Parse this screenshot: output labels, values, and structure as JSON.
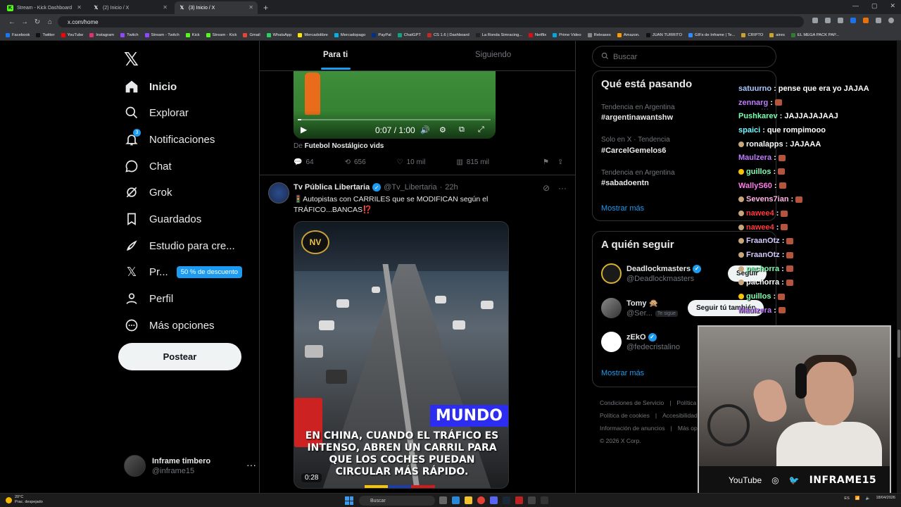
{
  "browser": {
    "tabs": [
      {
        "title": "Stream - Kick Dashboard",
        "active": false,
        "favicon": "kick-icon"
      },
      {
        "title": "(2) Inicio / X",
        "active": false,
        "favicon": "x-icon"
      },
      {
        "title": "(3) Inicio / X",
        "active": true,
        "favicon": "x-icon"
      }
    ],
    "url": "x.com/home",
    "bookmarks": [
      "Facebook",
      "Twitter",
      "YouTube",
      "Instagram",
      "Twitch",
      "Stream - Twitch",
      "Kick",
      "Stream - Kick",
      "Gmail",
      "WhatsApp",
      "Mercadolibre",
      "Mercadopago",
      "PayPal",
      "ChatGPT",
      "CS 1.6 | Dashboard",
      "La Ronda Simracing...",
      "Netflix",
      "Prime Video",
      "Releases",
      "Amazon.",
      "JUAN TURRITO",
      "GIFs de Inframe | Te...",
      "CRIPTO",
      "aires",
      "EL MEGA PACK PAP..."
    ]
  },
  "nav": {
    "items": [
      {
        "label": "Inicio",
        "icon": "home-icon"
      },
      {
        "label": "Explorar",
        "icon": "search-icon"
      },
      {
        "label": "Notificaciones",
        "icon": "bell-icon",
        "badge": "3"
      },
      {
        "label": "Chat",
        "icon": "chat-icon"
      },
      {
        "label": "Grok",
        "icon": "grok-icon"
      },
      {
        "label": "Guardados",
        "icon": "bookmark-icon"
      },
      {
        "label": "Estudio para cre...",
        "icon": "rocket-icon"
      },
      {
        "label": "Pr...",
        "icon": "x-premium-icon"
      },
      {
        "label": "Perfil",
        "icon": "user-icon"
      },
      {
        "label": "Más opciones",
        "icon": "more-icon"
      }
    ],
    "premium_badge": "50 % de descuento",
    "post_button": "Postear",
    "profile": {
      "name": "Inframe timbero",
      "handle": "@inframe15"
    }
  },
  "feed": {
    "tabs": [
      "Para ti",
      "Siguiendo"
    ],
    "tweet1": {
      "video_time": "0:07 / 1:00",
      "from_prefix": "De",
      "from_source": "Futebol Nostálgico vids",
      "replies": "64",
      "reposts": "656",
      "likes": "10 mil",
      "views": "815 mil"
    },
    "tweet2": {
      "name": "Tv Pública Libertaria",
      "handle": "@Tv_Libertaria",
      "time": "22h",
      "text_line1": "🚦Autopistas con CARRILES que se MODIFICAN según el",
      "text_line2": "TRÁFICO...BANCAS⁉️",
      "overlay_logo": "NV",
      "overlay_tag": "MUNDO",
      "overlay_caption": "EN CHINA, CUANDO EL TRÁFICO ES INTENSO, ABREN UN CARRIL PARA QUE LOS COCHES PUEDAN CIRCULAR MÁS RÁPIDO.",
      "duration": "0:28"
    }
  },
  "sidebar": {
    "search_placeholder": "Buscar",
    "trends_title": "Qué está pasando",
    "trends": [
      {
        "meta": "Tendencia en Argentina",
        "tag": "#argentinawantshw"
      },
      {
        "meta": "Solo en X · Tendencia",
        "tag": "#CarcelGemelos6"
      },
      {
        "meta": "Tendencia en Argentina",
        "tag": "#sabadoentn"
      }
    ],
    "show_more": "Mostrar más",
    "who_title": "A quién seguir",
    "who": [
      {
        "name": "Deadlockmasters",
        "handle": "@Deadlockmasters",
        "verified": true,
        "button": "Seguir"
      },
      {
        "name": "Tomy 🙊",
        "handle": "@Ser...",
        "follows_you": "Te sigue",
        "button": "Seguir tú también"
      },
      {
        "name": "zEkO",
        "handle": "@fedecristalino",
        "verified": true
      }
    ],
    "footer": [
      "Condiciones de Servicio",
      "Política",
      "Política de cookies",
      "Accesibilidad",
      "Información de anuncios",
      "Más op",
      "© 2026 X Corp."
    ]
  },
  "chat": [
    {
      "user": "satuurno",
      "msg": "pense que era yo JAJAA",
      "color": "#a8c8ff"
    },
    {
      "user": "zennarg",
      "msg": "",
      "color": "#c07cff",
      "emote": true
    },
    {
      "user": "Pushkarev",
      "msg": "JAJJAJAJAAJ",
      "color": "#7dffb0"
    },
    {
      "user": "spaici",
      "msg": "que rompimooo",
      "color": "#7df7ff"
    },
    {
      "user": "ronalapps",
      "msg": "JAJAAA",
      "color": "#ffffff",
      "badge": "#c9a57a"
    },
    {
      "user": "Maulzera",
      "msg": "",
      "color": "#c07cff",
      "emote": true
    },
    {
      "user": "guillos",
      "msg": "",
      "color": "#7dffb0",
      "badge": "#f5c400",
      "emote": true
    },
    {
      "user": "WallyS60",
      "msg": "",
      "color": "#ff7de9",
      "emote": true
    },
    {
      "user": "Sevens7ian",
      "msg": "",
      "color": "#ffb3e6",
      "badge": "#c9a57a",
      "emote": true
    },
    {
      "user": "nawee4",
      "msg": "",
      "color": "#ff3b3b",
      "badge": "#c9a57a",
      "emote": true
    },
    {
      "user": "nawee4",
      "msg": "",
      "color": "#ff3b3b",
      "badge": "#c9a57a",
      "emote": true
    },
    {
      "user": "FraanOtz",
      "msg": "",
      "color": "#d6c8ff",
      "badge": "#c9a57a",
      "emote": true
    },
    {
      "user": "FraanOtz",
      "msg": "",
      "color": "#d6c8ff",
      "badge": "#c9a57a",
      "emote": true
    },
    {
      "user": "pachorra",
      "msg": "",
      "color": "#7dffb0",
      "badge": "#c9a57a",
      "emote": true
    },
    {
      "user": "pachorra",
      "msg": "",
      "color": "#ffffff",
      "badge": "#c9a57a",
      "emote": true
    },
    {
      "user": "guillos",
      "msg": "",
      "color": "#7dffb0",
      "badge": "#f5c400",
      "emote": true
    },
    {
      "user": "Maulzera",
      "msg": "",
      "color": "#c07cff",
      "emote": true
    }
  ],
  "webcam": {
    "youtube": "YouTube",
    "brand": "INFRAME15"
  },
  "taskbar": {
    "weather_temp": "20°C",
    "weather_desc": "Prac. despejado",
    "search": "Buscar",
    "lang": "ES",
    "date": "18/04/2026"
  }
}
